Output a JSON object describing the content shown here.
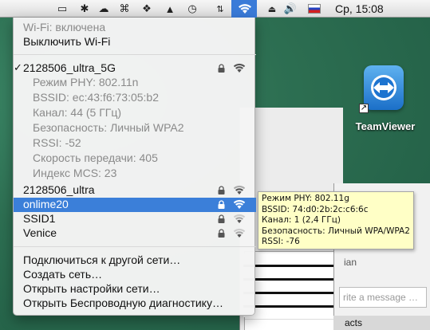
{
  "menubar": {
    "clock": "Ср, 15:08",
    "icons": [
      "display-icon",
      "bluetooth-icon",
      "cloud-icon",
      "keyboard-icon",
      "dropbox-icon",
      "airplay-icon",
      "timemachine-icon",
      "network-activity-icon",
      "wifi-icon",
      "eject-icon",
      "volume-icon",
      "russian-flag-icon"
    ]
  },
  "wifi_menu": {
    "status": "Wi-Fi: включена",
    "toggle": "Выключить Wi-Fi",
    "current": {
      "name": "2128506_ultra_5G",
      "details": [
        "Режим PHY: 802.11n",
        "BSSID: ec:43:f6:73:05:b2",
        "Канал: 44 (5 ГГц)",
        "Безопасность: Личный WPA2",
        "RSSI: -52",
        "Скорость передачи: 405",
        "Индекс MCS: 23"
      ]
    },
    "networks": [
      {
        "name": "2128506_ultra",
        "locked": true,
        "signal": 3
      },
      {
        "name": "onlime20",
        "locked": true,
        "signal": 3,
        "selected": true
      },
      {
        "name": "SSID1",
        "locked": true,
        "signal": 2
      },
      {
        "name": "Venice",
        "locked": true,
        "signal": 2
      }
    ],
    "actions": [
      "Подключиться к другой сети…",
      "Создать сеть…",
      "Открыть настройки сети…",
      "Открыть Беспроводную диагностику…"
    ]
  },
  "tooltip": {
    "lines": [
      "Режим PHY: 802.11g",
      "BSSID: 74:d0:2b:2c:c6:6c",
      "Канал: 1 (2,4 ГГц)",
      "Безопасность: Личный WPA/WPA2",
      "RSSI: -76"
    ]
  },
  "desktop": {
    "app_label": "TeamViewer",
    "chat_placeholder": "rite a message …",
    "chat_partial_label": "ian",
    "contacts_partial": "acts"
  },
  "colors": {
    "selection": "#3b7fd9",
    "tooltip_bg": "#ffffc6"
  }
}
